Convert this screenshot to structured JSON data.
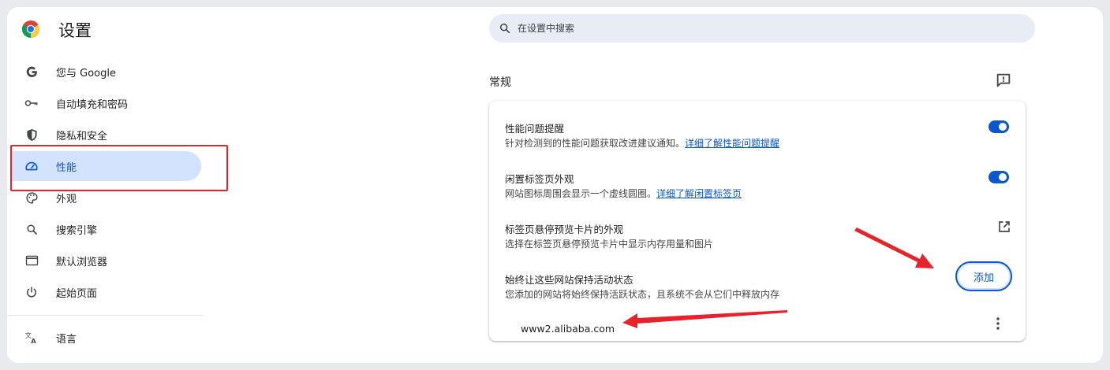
{
  "app": {
    "title": "设置",
    "logo_icon": "chrome-logo-icon"
  },
  "search": {
    "placeholder": "在设置中搜索",
    "value": ""
  },
  "sidebar": {
    "items": [
      {
        "label": "您与 Google",
        "icon": "google-g-icon"
      },
      {
        "label": "自动填充和密码",
        "icon": "key-icon"
      },
      {
        "label": "隐私和安全",
        "icon": "shield-icon"
      },
      {
        "label": "性能",
        "icon": "speedometer-icon",
        "active": true
      },
      {
        "label": "外观",
        "icon": "palette-icon"
      },
      {
        "label": "搜索引擎",
        "icon": "search-icon"
      },
      {
        "label": "默认浏览器",
        "icon": "browser-window-icon"
      },
      {
        "label": "起始页面",
        "icon": "power-icon"
      },
      {
        "label": "语言",
        "icon": "translate-icon"
      }
    ]
  },
  "main": {
    "section_title": "常规",
    "rows": [
      {
        "title": "性能问题提醒",
        "desc": "针对检测到的性能问题获取改进建议通知。",
        "link": "详细了解性能问题提醒",
        "toggle": "on"
      },
      {
        "title": "闲置标签页外观",
        "desc": "网站图标周围会显示一个虚线圆圈。",
        "link": "详细了解闲置标签页",
        "toggle": "on"
      },
      {
        "title": "标签页悬停预览卡片的外观",
        "desc": "选择在标签页悬停预览卡片中显示内存用量和图片"
      },
      {
        "title": "始终让这些网站保持活动状态",
        "desc": "您添加的网站将始终保持活跃状态，且系统不会从它们中释放内存",
        "button": "添加"
      }
    ],
    "sites": [
      "www2.alibaba.com"
    ]
  },
  "colors": {
    "accent": "#0b57d0",
    "active_bg": "#d3e3fd",
    "annotation_red": "#e8222a"
  }
}
